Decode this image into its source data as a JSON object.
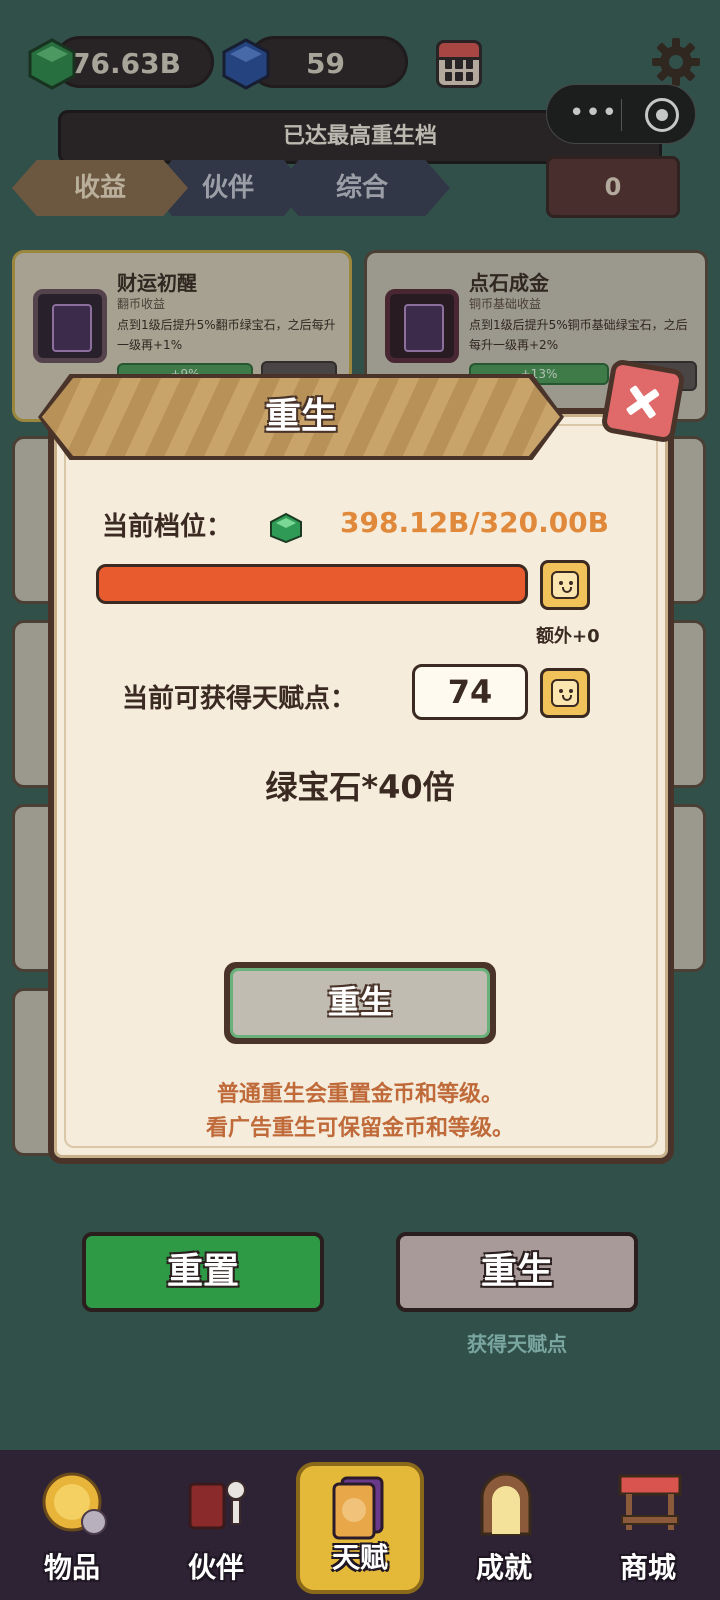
{
  "top_bar": {
    "emerald_count": "76.63B",
    "sapphire_count": "59"
  },
  "banner": "已达最高重生档",
  "tabs": [
    "收益",
    "伙伴",
    "综合"
  ],
  "count_box": "0",
  "talent_cards": [
    {
      "name": "财运初醒",
      "subtitle": "翻币收益",
      "desc": "点到1级后提升5%翻币绿宝石，之后每升一级再+1%",
      "bar": "+9%"
    },
    {
      "name": "点石成金",
      "subtitle": "铜币基础收益",
      "desc": "点到1级后提升5%铜币基础绿宝石，之后每升一级再+2%",
      "bar": "+13%"
    }
  ],
  "modal": {
    "title": "重生",
    "tier_label": "当前档位：",
    "tier_value": "398.12B/320.00B",
    "progress": 1.0,
    "extra_label": "额外+0",
    "talent_label": "当前可获得天赋点：",
    "talent_value": "74",
    "multiplier": "绿宝石*40倍",
    "rebirth_button": "重生",
    "note_line1": "普通重生会重置金币和等级。",
    "note_line2": "看广告重生可保留金币和等级。"
  },
  "bottom": {
    "reset_button": "重置",
    "rebirth_button": "重生",
    "gain_label": "获得天赋点"
  },
  "nav": [
    {
      "label": "物品",
      "icon": "cat-coin-icon",
      "active": false
    },
    {
      "label": "伙伴",
      "icon": "book-skeleton-icon",
      "active": false
    },
    {
      "label": "天赋",
      "icon": "cat-cards-icon",
      "active": true
    },
    {
      "label": "成就",
      "icon": "portal-icon",
      "active": false
    },
    {
      "label": "商城",
      "icon": "shop-stall-icon",
      "active": false
    }
  ],
  "colors": {
    "accent_orange": "#e0893a",
    "progress_fill": "#e75b2e",
    "reset_green": "#2e9a46",
    "close_red": "#e06a6a"
  }
}
